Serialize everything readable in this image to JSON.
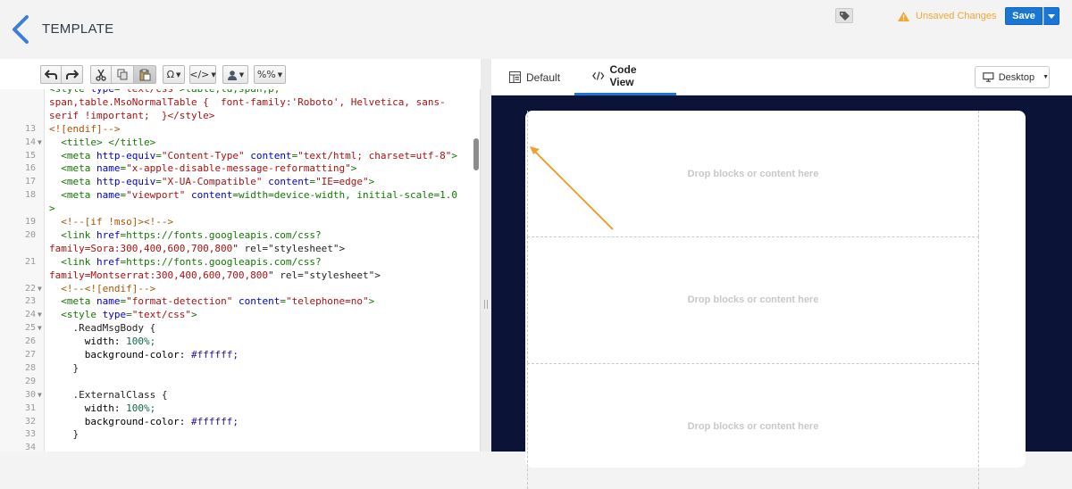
{
  "header": {
    "title": "TEMPLATE",
    "unsaved_label": "Unsaved Changes",
    "save_label": "Save",
    "accent": "#1976d2",
    "warning_color": "#f0a830"
  },
  "toolbar": {
    "buttons": [
      "undo",
      "redo",
      "cut",
      "copy",
      "paste",
      "special-character",
      "code-snippet",
      "personalize",
      "merge-tag"
    ],
    "omega_label": "Ω",
    "code_label": "</>",
    "percent_label": "%%"
  },
  "code": {
    "lines": [
      {
        "n": "",
        "fold": false,
        "text": "<style type=\"text/css\">table,td,span,p,"
      },
      {
        "n": "",
        "fold": false,
        "text": "span,table.MsoNormalTable {  font-family:'Roboto', Helvetica, sans-"
      },
      {
        "n": "",
        "fold": false,
        "text": "serif !important;  }</style>"
      },
      {
        "n": "13",
        "fold": false,
        "text": "<![endif]-->"
      },
      {
        "n": "14",
        "fold": true,
        "text": "  <title> </title>"
      },
      {
        "n": "15",
        "fold": false,
        "text": "  <meta http-equiv=\"Content-Type\" content=\"text/html; charset=utf-8\">"
      },
      {
        "n": "16",
        "fold": false,
        "text": "  <meta name=\"x-apple-disable-message-reformatting\">"
      },
      {
        "n": "17",
        "fold": false,
        "text": "  <meta http-equiv=\"X-UA-Compatible\" content=\"IE=edge\">"
      },
      {
        "n": "18",
        "fold": false,
        "text": "  <meta name=\"viewport\" content=\"width=device-width, initial-scale=1.0"
      },
      {
        "n": "",
        "fold": false,
        "text": "\">"
      },
      {
        "n": "19",
        "fold": false,
        "text": "  <!--[if !mso]><!-->"
      },
      {
        "n": "20",
        "fold": false,
        "text": "  <link href=\"https://fonts.googleapis.com/css?"
      },
      {
        "n": "",
        "fold": false,
        "text": "family=Sora:300,400,600,700,800\" rel=\"stylesheet\">"
      },
      {
        "n": "21",
        "fold": false,
        "text": "  <link href=\"https://fonts.googleapis.com/css?"
      },
      {
        "n": "",
        "fold": false,
        "text": "family=Montserrat:300,400,600,700,800\" rel=\"stylesheet\">"
      },
      {
        "n": "22",
        "fold": true,
        "text": "  <!--<![endif]-->"
      },
      {
        "n": "23",
        "fold": false,
        "text": "  <meta name=\"format-detection\" content=\"telephone=no\">"
      },
      {
        "n": "24",
        "fold": true,
        "text": "  <style type=\"text/css\">"
      },
      {
        "n": "25",
        "fold": true,
        "text": "    .ReadMsgBody {"
      },
      {
        "n": "26",
        "fold": false,
        "text": "      width: 100%;"
      },
      {
        "n": "27",
        "fold": false,
        "text": "      background-color: #ffffff;"
      },
      {
        "n": "28",
        "fold": false,
        "text": "    }"
      },
      {
        "n": "29",
        "fold": false,
        "text": ""
      },
      {
        "n": "30",
        "fold": true,
        "text": "    .ExternalClass {"
      },
      {
        "n": "31",
        "fold": false,
        "text": "      width: 100%;"
      },
      {
        "n": "32",
        "fold": false,
        "text": "      background-color: #ffffff;"
      },
      {
        "n": "33",
        "fold": false,
        "text": "    }"
      },
      {
        "n": "34",
        "fold": false,
        "text": ""
      }
    ]
  },
  "preview": {
    "tabs": [
      {
        "label": "Default",
        "active": false
      },
      {
        "label": "Code View",
        "active": true
      }
    ],
    "device_label": "Desktop",
    "drop_label": "Drop blocks or content here",
    "canvas_bg": "#0b1437"
  }
}
